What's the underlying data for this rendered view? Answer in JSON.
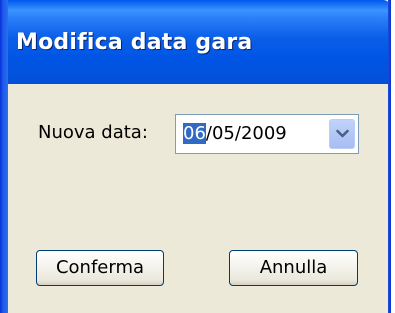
{
  "dialog": {
    "title": "Modifica data gara",
    "date_label": "Nuova data:",
    "date_field": {
      "selected_part": "06",
      "rest": "/05/2009",
      "dropdown_icon": "chevron-down-icon"
    },
    "confirm_label": "Conferma",
    "cancel_label": "Annulla"
  },
  "colors": {
    "titlebar": "#0055e5",
    "body": "#ece9d8",
    "selection": "#316ac5"
  }
}
